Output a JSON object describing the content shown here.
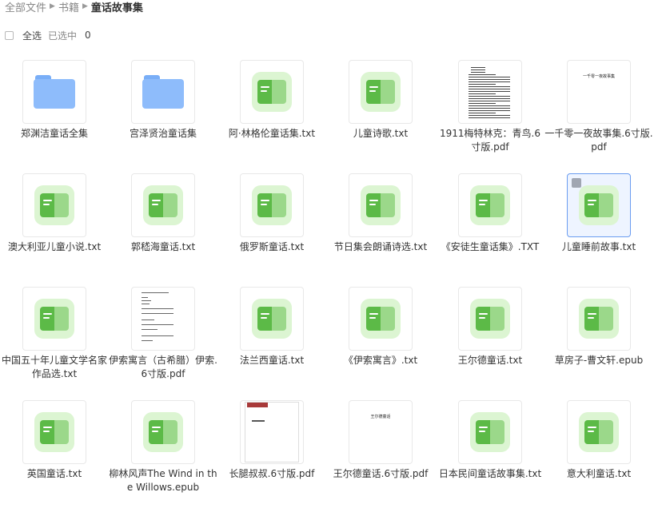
{
  "breadcrumb": {
    "items": [
      "全部文件",
      "书籍",
      "童话故事集"
    ],
    "separator_icon": "caret-right-icon"
  },
  "selection": {
    "select_all_label": "全选",
    "selected_label": "已选中",
    "selected_count": "0"
  },
  "files": [
    {
      "name": "郑渊洁童话全集",
      "type": "folder"
    },
    {
      "name": "宫泽贤治童话集",
      "type": "folder"
    },
    {
      "name": "阿·林格伦童话集.txt",
      "type": "txt"
    },
    {
      "name": "儿童诗歌.txt",
      "type": "txt"
    },
    {
      "name": "1911梅特林克：青鸟.6寸版.pdf",
      "type": "pdf-text"
    },
    {
      "name": "一千零一夜故事集.6寸版.pdf",
      "type": "pdf-title",
      "cover_title": "一千零一夜故事集"
    },
    {
      "name": "澳大利亚儿童小说.txt",
      "type": "txt"
    },
    {
      "name": "郭嵇海童话.txt",
      "type": "txt"
    },
    {
      "name": "俄罗斯童话.txt",
      "type": "txt"
    },
    {
      "name": "节日集会朗诵诗选.txt",
      "type": "txt"
    },
    {
      "name": "《安徒生童话集》.TXT",
      "type": "txt"
    },
    {
      "name": "儿童睡前故事.txt",
      "type": "txt",
      "selected": true
    },
    {
      "name": "中国五十年儿童文学名家作品选.txt",
      "type": "txt"
    },
    {
      "name": "伊索寓言（古希腊）伊索.6寸版.pdf",
      "type": "pdf-toc"
    },
    {
      "name": "法兰西童话.txt",
      "type": "txt"
    },
    {
      "name": "《伊索寓言》.txt",
      "type": "txt"
    },
    {
      "name": "王尔德童话.txt",
      "type": "txt"
    },
    {
      "name": "草房子-曹文轩.epub",
      "type": "txt"
    },
    {
      "name": "英国童话.txt",
      "type": "txt"
    },
    {
      "name": "柳林风声The Wind in the Willows.epub",
      "type": "txt"
    },
    {
      "name": "长腿叔叔.6寸版.pdf",
      "type": "pdf-red"
    },
    {
      "name": "王尔德童话.6寸版.pdf",
      "type": "pdf-title",
      "cover_title": "王尔德童话"
    },
    {
      "name": "日本民间童话故事集.txt",
      "type": "txt"
    },
    {
      "name": "意大利童话.txt",
      "type": "txt"
    }
  ],
  "colors": {
    "txt_icon_bg": "#dcf5d2",
    "txt_icon_green": "#5cba47",
    "folder_blue": "#8ebcfb",
    "selection_border": "#6a9cf0"
  }
}
